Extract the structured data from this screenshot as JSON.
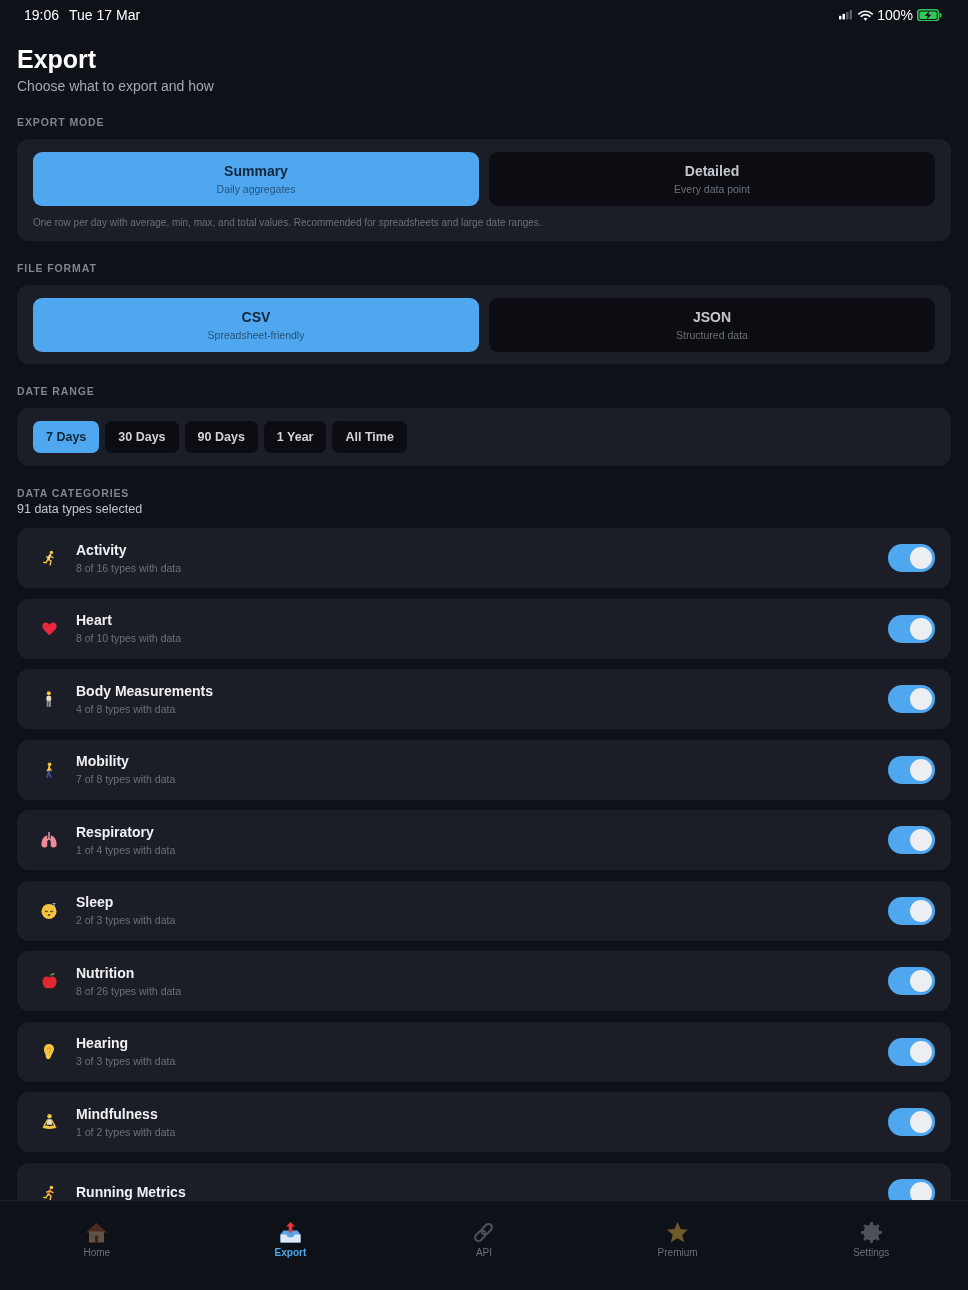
{
  "status_bar": {
    "time": "19:06",
    "date": "Tue 17 Mar",
    "battery": "100%"
  },
  "header": {
    "title": "Export",
    "subtitle": "Choose what to export and how"
  },
  "export_mode": {
    "label": "EXPORT MODE",
    "options": [
      {
        "title": "Summary",
        "subtitle": "Daily aggregates",
        "selected": true
      },
      {
        "title": "Detailed",
        "subtitle": "Every data point",
        "selected": false
      }
    ],
    "description": "One row per day with average, min, max, and total values. Recommended for spreadsheets and large date ranges."
  },
  "file_format": {
    "label": "FILE FORMAT",
    "options": [
      {
        "title": "CSV",
        "subtitle": "Spreadsheet-friendly",
        "selected": true
      },
      {
        "title": "JSON",
        "subtitle": "Structured data",
        "selected": false
      }
    ]
  },
  "date_range": {
    "label": "DATE RANGE",
    "options": [
      {
        "label": "7 Days",
        "selected": true
      },
      {
        "label": "30 Days",
        "selected": false
      },
      {
        "label": "90 Days",
        "selected": false
      },
      {
        "label": "1 Year",
        "selected": false
      },
      {
        "label": "All Time",
        "selected": false
      }
    ]
  },
  "data_categories": {
    "label": "DATA CATEGORIES",
    "summary": "91 data types selected",
    "items": [
      {
        "title": "Activity",
        "subtitle": "8 of 16 types with data",
        "on": true
      },
      {
        "title": "Heart",
        "subtitle": "8 of 10 types with data",
        "on": true
      },
      {
        "title": "Body Measurements",
        "subtitle": "4 of 8 types with data",
        "on": true
      },
      {
        "title": "Mobility",
        "subtitle": "7 of 8 types with data",
        "on": true
      },
      {
        "title": "Respiratory",
        "subtitle": "1 of 4 types with data",
        "on": true
      },
      {
        "title": "Sleep",
        "subtitle": "2 of 3 types with data",
        "on": true
      },
      {
        "title": "Nutrition",
        "subtitle": "8 of 26 types with data",
        "on": true
      },
      {
        "title": "Hearing",
        "subtitle": "3 of 3 types with data",
        "on": true
      },
      {
        "title": "Mindfulness",
        "subtitle": "1 of 2 types with data",
        "on": true
      },
      {
        "title": "Running Metrics",
        "on": true
      }
    ]
  },
  "tab_bar": [
    {
      "label": "Home",
      "selected": false
    },
    {
      "label": "Export",
      "selected": true
    },
    {
      "label": "API",
      "selected": false
    },
    {
      "label": "Premium",
      "selected": false
    },
    {
      "label": "Settings",
      "selected": false
    }
  ]
}
